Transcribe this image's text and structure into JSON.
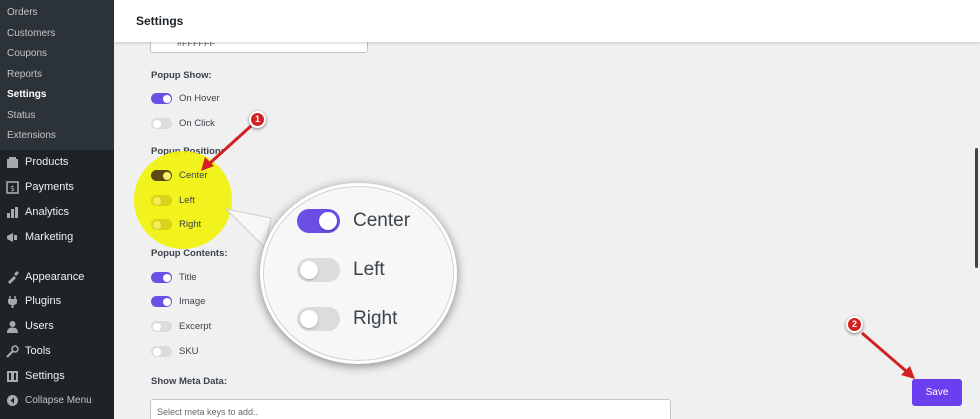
{
  "page": {
    "title": "Settings"
  },
  "sidebar": {
    "submenu": [
      {
        "label": "Orders",
        "current": false
      },
      {
        "label": "Customers",
        "current": false
      },
      {
        "label": "Coupons",
        "current": false
      },
      {
        "label": "Reports",
        "current": false
      },
      {
        "label": "Settings",
        "current": true
      },
      {
        "label": "Status",
        "current": false
      },
      {
        "label": "Extensions",
        "current": false
      }
    ],
    "menu": [
      {
        "label": "Products",
        "icon": "products-icon"
      },
      {
        "label": "Payments",
        "icon": "payments-icon"
      },
      {
        "label": "Analytics",
        "icon": "analytics-icon"
      },
      {
        "label": "Marketing",
        "icon": "marketing-icon"
      },
      {
        "label": "Appearance",
        "icon": "appearance-icon"
      },
      {
        "label": "Plugins",
        "icon": "plugins-icon"
      },
      {
        "label": "Users",
        "icon": "users-icon"
      },
      {
        "label": "Tools",
        "icon": "tools-icon"
      },
      {
        "label": "Settings",
        "icon": "settings-icon"
      }
    ],
    "collapse_label": "Collapse Menu"
  },
  "form": {
    "color_value": "#FFFFFF",
    "popup_show": {
      "label": "Popup Show:",
      "options": [
        {
          "label": "On Hover",
          "enabled": true
        },
        {
          "label": "On Click",
          "enabled": false
        }
      ]
    },
    "popup_position": {
      "label": "Popup Position:",
      "options": [
        {
          "label": "Center",
          "enabled": true
        },
        {
          "label": "Left",
          "enabled": false
        },
        {
          "label": "Right",
          "enabled": false
        }
      ]
    },
    "popup_contents": {
      "label": "Popup Contents:",
      "options": [
        {
          "label": "Title",
          "enabled": true
        },
        {
          "label": "Image",
          "enabled": true
        },
        {
          "label": "Excerpt",
          "enabled": false
        },
        {
          "label": "SKU",
          "enabled": false
        }
      ]
    },
    "meta": {
      "label": "Show Meta Data:",
      "placeholder": "Select meta keys to add.."
    },
    "save_label": "Save"
  },
  "annotations": {
    "badge_1": "1",
    "badge_2": "2",
    "zoom": [
      {
        "label": "Center",
        "enabled": true
      },
      {
        "label": "Left",
        "enabled": false
      },
      {
        "label": "Right",
        "enabled": false
      }
    ]
  },
  "colors": {
    "accent": "#6b4ee6",
    "save_button": "#6b3ff0",
    "sidebar_bg": "#1d2327",
    "highlight": "#f2f20a",
    "annotation_red": "#d32020"
  }
}
